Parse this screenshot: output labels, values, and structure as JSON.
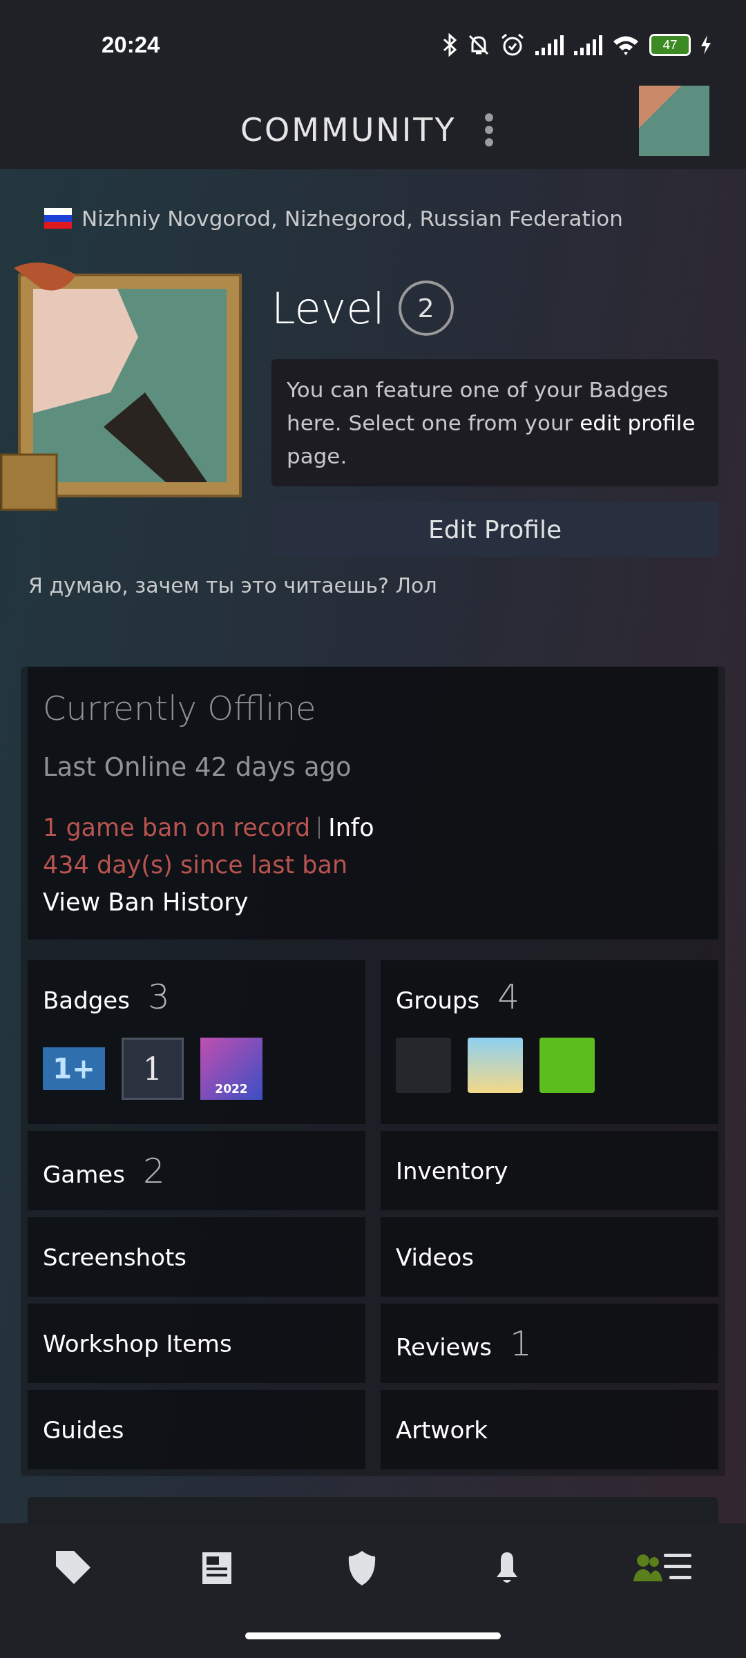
{
  "status_bar": {
    "time": "20:24",
    "battery": "47"
  },
  "header": {
    "title": "COMMUNITY"
  },
  "profile": {
    "location": "Nizhniy Novgorod, Nizhegorod, Russian Federation",
    "level_label": "Level",
    "level": "2",
    "badge_hint": "You can feature one of your Badges here. Select one from your **edit profile** page.",
    "edit_button": "Edit Profile",
    "summary": "Я думаю, зачем ты это читаешь? Лол"
  },
  "status": {
    "state": "Currently Offline",
    "last_online": "Last Online 42 days ago",
    "ban_record": "1 game ban on record",
    "ban_info": "Info",
    "ban_days": "434 day(s) since last ban",
    "ban_history": "View Ban History"
  },
  "tiles": [
    {
      "kind": "badges",
      "label": "Badges",
      "count": "3",
      "badges": [
        {
          "kind": "years",
          "text": "1+"
        },
        {
          "kind": "level",
          "text": "1"
        },
        {
          "kind": "steam",
          "text": "2022"
        }
      ]
    },
    {
      "kind": "groups",
      "label": "Groups",
      "count": "4",
      "groups": [
        {
          "kind": "dark"
        },
        {
          "kind": "beach"
        },
        {
          "kind": "green"
        }
      ]
    },
    {
      "kind": "plain",
      "label": "Games",
      "count": "2"
    },
    {
      "kind": "plain",
      "label": "Inventory"
    },
    {
      "kind": "plain",
      "label": "Screenshots"
    },
    {
      "kind": "plain",
      "label": "Videos"
    },
    {
      "kind": "plain",
      "label": "Workshop Items"
    },
    {
      "kind": "plain",
      "label": "Reviews",
      "count": "1"
    },
    {
      "kind": "plain",
      "label": "Guides"
    },
    {
      "kind": "plain",
      "label": "Artwork"
    }
  ],
  "nav": [
    {
      "kind": "store",
      "selected": false
    },
    {
      "kind": "news",
      "selected": false
    },
    {
      "kind": "guard",
      "selected": false
    },
    {
      "kind": "notifications",
      "selected": false
    },
    {
      "kind": "community",
      "selected": true
    }
  ]
}
